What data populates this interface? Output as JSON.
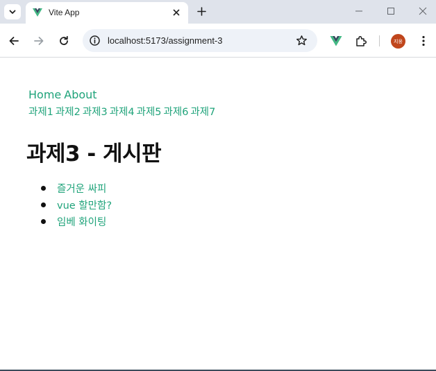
{
  "browser": {
    "tab_title": "Vite App",
    "url": "localhost:5173/assignment-3",
    "profile_initials": "지웅",
    "accent_color": "#1fa37a",
    "profile_color": "#c0461c",
    "icons": [
      "tab-search-icon",
      "vue-logo-icon",
      "close-icon",
      "plus-icon",
      "minimize-icon",
      "maximize-icon",
      "window-close-icon",
      "back-arrow-icon",
      "forward-arrow-icon",
      "reload-icon",
      "site-info-icon",
      "bookmark-star-icon",
      "vue-devtools-icon",
      "puzzle-extensions-icon",
      "kebab-menu-icon"
    ]
  },
  "nav": {
    "home": "Home",
    "about": "About"
  },
  "assignments": [
    {
      "label": "과제1"
    },
    {
      "label": "과제2"
    },
    {
      "label": "과제3"
    },
    {
      "label": "과제4"
    },
    {
      "label": "과제5"
    },
    {
      "label": "과제6"
    },
    {
      "label": "과제7"
    }
  ],
  "page": {
    "title": "과제3 - 게시판"
  },
  "posts": [
    {
      "title": "즐거운 싸피"
    },
    {
      "title": "vue 할만함?"
    },
    {
      "title": "임베 화이팅"
    }
  ]
}
